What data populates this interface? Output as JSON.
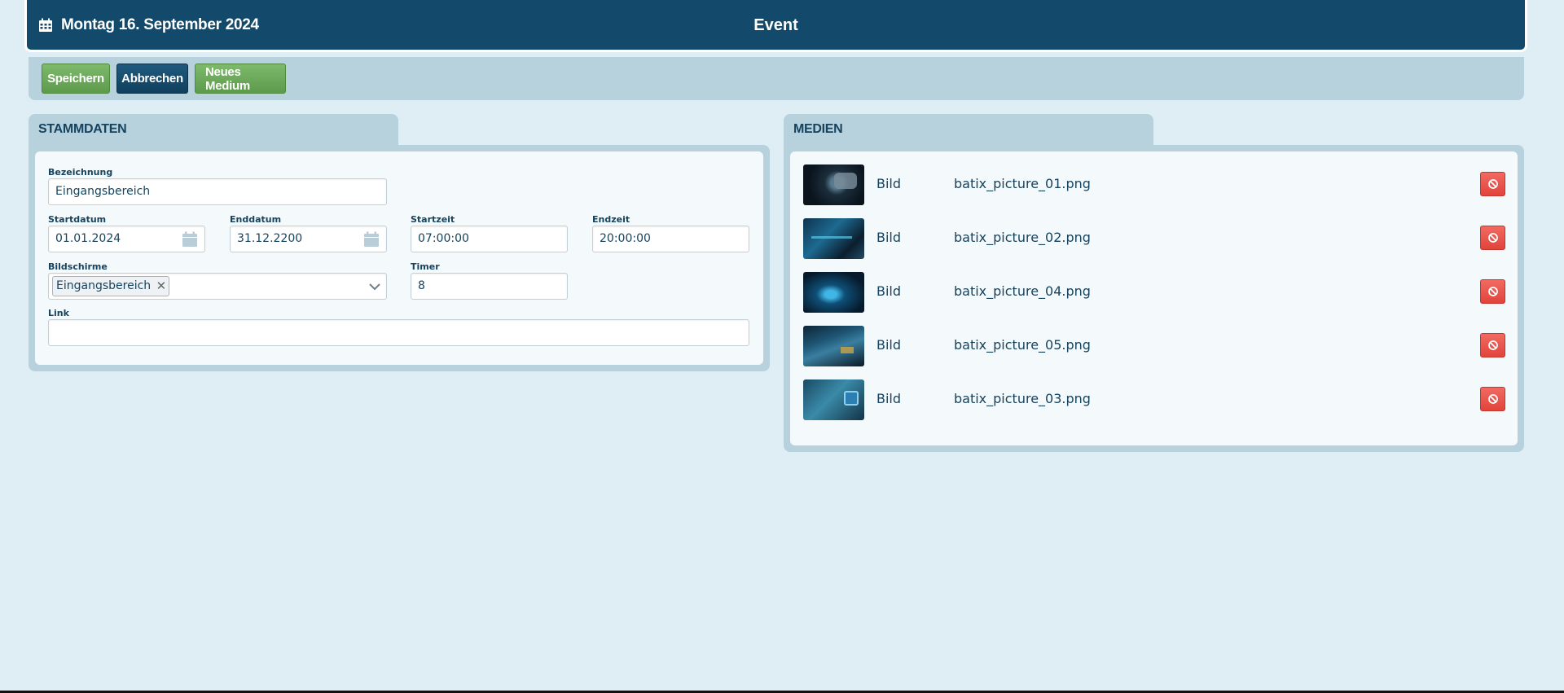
{
  "header": {
    "date": "Montag 16. September 2024",
    "title": "Event"
  },
  "toolbar": {
    "save_label": "Speichern",
    "cancel_label": "Abbrechen",
    "new_media_label": "Neues Medium"
  },
  "stammdaten": {
    "tab_label": "STAMMDATEN",
    "bezeichnung": {
      "label": "Bezeichnung",
      "value": "Eingangsbereich"
    },
    "startdatum": {
      "label": "Startdatum",
      "value": "01.01.2024"
    },
    "enddatum": {
      "label": "Enddatum",
      "value": "31.12.2200"
    },
    "startzeit": {
      "label": "Startzeit",
      "value": "07:00:00"
    },
    "endzeit": {
      "label": "Endzeit",
      "value": "20:00:00"
    },
    "bildschirme": {
      "label": "Bildschirme",
      "selected": [
        "Eingangsbereich"
      ]
    },
    "timer": {
      "label": "Timer",
      "value": "8"
    },
    "link": {
      "label": "Link",
      "value": ""
    }
  },
  "medien": {
    "tab_label": "MEDIEN",
    "items": [
      {
        "type": "Bild",
        "filename": "batix_picture_01.png"
      },
      {
        "type": "Bild",
        "filename": "batix_picture_02.png"
      },
      {
        "type": "Bild",
        "filename": "batix_picture_04.png"
      },
      {
        "type": "Bild",
        "filename": "batix_picture_05.png"
      },
      {
        "type": "Bild",
        "filename": "batix_picture_03.png"
      }
    ]
  },
  "colors": {
    "header_bg": "#13496a",
    "panel_bg": "#b7d1dd",
    "page_bg": "#dfedf5",
    "green_button": "#6aa957",
    "blue_button": "#13496a",
    "delete_button": "#e8504a"
  },
  "icons": {
    "header_date": "calendar-icon",
    "date_fields": "calendar-icon",
    "select": "chevron-down-icon",
    "chip_remove": "close-icon",
    "media_delete": "ban-icon"
  }
}
